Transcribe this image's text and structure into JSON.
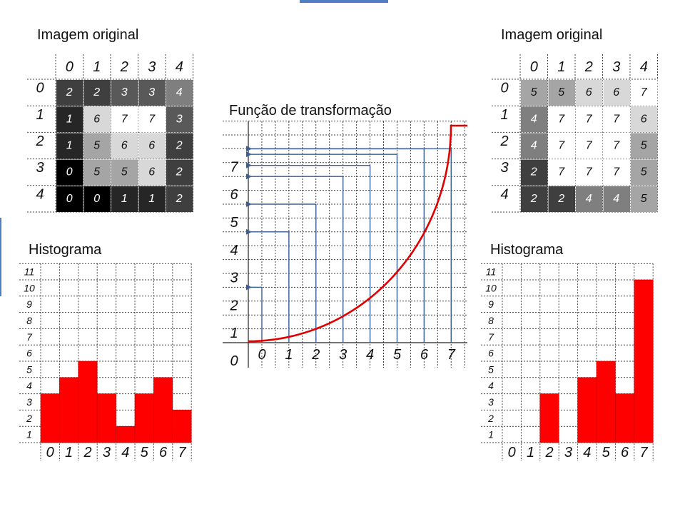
{
  "left_panel": {
    "image_title": "Imagem original",
    "col_headers": [
      "0",
      "1",
      "2",
      "3",
      "4"
    ],
    "row_headers": [
      "0",
      "1",
      "2",
      "3",
      "4"
    ],
    "pixels": [
      [
        2,
        2,
        3,
        3,
        4
      ],
      [
        1,
        6,
        7,
        7,
        3
      ],
      [
        1,
        5,
        6,
        6,
        2
      ],
      [
        0,
        5,
        5,
        6,
        2
      ],
      [
        0,
        0,
        1,
        1,
        2
      ]
    ],
    "histogram_title": "Histograma",
    "histogram_x_labels": [
      "0",
      "1",
      "2",
      "3",
      "4",
      "5",
      "6",
      "7"
    ],
    "histogram_y_labels": [
      "1",
      "2",
      "3",
      "4",
      "5",
      "6",
      "7",
      "8",
      "9",
      "10",
      "11"
    ],
    "histogram_values": [
      3,
      4,
      5,
      3,
      1,
      3,
      4,
      2
    ]
  },
  "right_panel": {
    "image_title": "Imagem original",
    "col_headers": [
      "0",
      "1",
      "2",
      "3",
      "4"
    ],
    "row_headers": [
      "0",
      "1",
      "2",
      "3",
      "4"
    ],
    "pixels": [
      [
        5,
        5,
        6,
        6,
        7
      ],
      [
        4,
        7,
        7,
        7,
        6
      ],
      [
        4,
        7,
        7,
        7,
        5
      ],
      [
        2,
        7,
        7,
        7,
        5
      ],
      [
        2,
        2,
        4,
        4,
        5
      ]
    ],
    "histogram_title": "Histograma",
    "histogram_x_labels": [
      "0",
      "1",
      "2",
      "3",
      "4",
      "5",
      "6",
      "7"
    ],
    "histogram_y_labels": [
      "1",
      "2",
      "3",
      "4",
      "5",
      "6",
      "7",
      "8",
      "9",
      "10",
      "11"
    ],
    "histogram_values": [
      0,
      0,
      3,
      0,
      4,
      5,
      3,
      10
    ]
  },
  "transform": {
    "title": "Função de transformação",
    "x_labels": [
      "0",
      "1",
      "2",
      "3",
      "4",
      "5",
      "6",
      "7"
    ],
    "y_labels": [
      "0",
      "1",
      "2",
      "3",
      "4",
      "5",
      "6",
      "7"
    ],
    "mapping": [
      2,
      4,
      5,
      6,
      6.4,
      6.8,
      7,
      7
    ]
  },
  "colors": {
    "histogram_bar": "#ff0000",
    "curve": "#e00000",
    "arrows": "#3a5f96",
    "grid": "#444444",
    "accent": "#4f7fc0",
    "gray_levels": [
      "#000000",
      "#262626",
      "#3f3f3f",
      "#595959",
      "#7f7f7f",
      "#a5a5a5",
      "#d8d8d8",
      "#ffffff"
    ]
  }
}
